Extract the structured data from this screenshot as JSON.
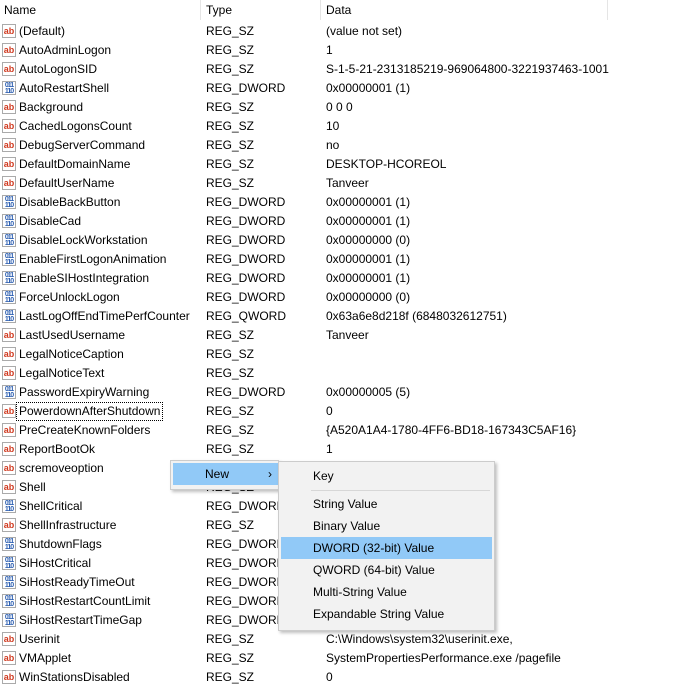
{
  "header": {
    "name": "Name",
    "type": "Type",
    "data": "Data"
  },
  "rows": [
    {
      "name": "(Default)",
      "type": "REG_SZ",
      "data": "(value not set)",
      "icon": "string"
    },
    {
      "name": "AutoAdminLogon",
      "type": "REG_SZ",
      "data": "1",
      "icon": "string"
    },
    {
      "name": "AutoLogonSID",
      "type": "REG_SZ",
      "data": "S-1-5-21-2313185219-969064800-3221937463-1001",
      "icon": "string"
    },
    {
      "name": "AutoRestartShell",
      "type": "REG_DWORD",
      "data": "0x00000001 (1)",
      "icon": "binary"
    },
    {
      "name": "Background",
      "type": "REG_SZ",
      "data": "0 0 0",
      "icon": "string"
    },
    {
      "name": "CachedLogonsCount",
      "type": "REG_SZ",
      "data": "10",
      "icon": "string"
    },
    {
      "name": "DebugServerCommand",
      "type": "REG_SZ",
      "data": "no",
      "icon": "string"
    },
    {
      "name": "DefaultDomainName",
      "type": "REG_SZ",
      "data": "DESKTOP-HCOREOL",
      "icon": "string"
    },
    {
      "name": "DefaultUserName",
      "type": "REG_SZ",
      "data": "Tanveer",
      "icon": "string"
    },
    {
      "name": "DisableBackButton",
      "type": "REG_DWORD",
      "data": "0x00000001 (1)",
      "icon": "binary"
    },
    {
      "name": "DisableCad",
      "type": "REG_DWORD",
      "data": "0x00000001 (1)",
      "icon": "binary"
    },
    {
      "name": "DisableLockWorkstation",
      "type": "REG_DWORD",
      "data": "0x00000000 (0)",
      "icon": "binary"
    },
    {
      "name": "EnableFirstLogonAnimation",
      "type": "REG_DWORD",
      "data": "0x00000001 (1)",
      "icon": "binary"
    },
    {
      "name": "EnableSIHostIntegration",
      "type": "REG_DWORD",
      "data": "0x00000001 (1)",
      "icon": "binary"
    },
    {
      "name": "ForceUnlockLogon",
      "type": "REG_DWORD",
      "data": "0x00000000 (0)",
      "icon": "binary"
    },
    {
      "name": "LastLogOffEndTimePerfCounter",
      "type": "REG_QWORD",
      "data": "0x63a6e8d218f (6848032612751)",
      "icon": "binary"
    },
    {
      "name": "LastUsedUsername",
      "type": "REG_SZ",
      "data": "Tanveer",
      "icon": "string"
    },
    {
      "name": "LegalNoticeCaption",
      "type": "REG_SZ",
      "data": "",
      "icon": "string"
    },
    {
      "name": "LegalNoticeText",
      "type": "REG_SZ",
      "data": "",
      "icon": "string"
    },
    {
      "name": "PasswordExpiryWarning",
      "type": "REG_DWORD",
      "data": "0x00000005 (5)",
      "icon": "binary"
    },
    {
      "name": "PowerdownAfterShutdown",
      "type": "REG_SZ",
      "data": "0",
      "icon": "string",
      "focused": true
    },
    {
      "name": "PreCreateKnownFolders",
      "type": "REG_SZ",
      "data": "{A520A1A4-1780-4FF6-BD18-167343C5AF16}",
      "icon": "string"
    },
    {
      "name": "ReportBootOk",
      "type": "REG_SZ",
      "data": "1",
      "icon": "string"
    },
    {
      "name": "scremoveoption",
      "type": "",
      "data": "",
      "icon": "string"
    },
    {
      "name": "Shell",
      "type": "REG_SZ",
      "data": "",
      "icon": "string"
    },
    {
      "name": "ShellCritical",
      "type": "REG_DWORD",
      "data": "",
      "icon": "binary"
    },
    {
      "name": "ShellInfrastructure",
      "type": "REG_SZ",
      "data": "",
      "icon": "string"
    },
    {
      "name": "ShutdownFlags",
      "type": "REG_DWORD",
      "data": "",
      "icon": "binary"
    },
    {
      "name": "SiHostCritical",
      "type": "REG_DWORD",
      "data": "",
      "icon": "binary"
    },
    {
      "name": "SiHostReadyTimeOut",
      "type": "REG_DWORD",
      "data": "",
      "icon": "binary"
    },
    {
      "name": "SiHostRestartCountLimit",
      "type": "REG_DWORD",
      "data": "",
      "icon": "binary"
    },
    {
      "name": "SiHostRestartTimeGap",
      "type": "REG_DWORD",
      "data": "",
      "icon": "binary"
    },
    {
      "name": "Userinit",
      "type": "REG_SZ",
      "data": "C:\\Windows\\system32\\userinit.exe,",
      "icon": "string"
    },
    {
      "name": "VMApplet",
      "type": "REG_SZ",
      "data": "SystemPropertiesPerformance.exe /pagefile",
      "icon": "string"
    },
    {
      "name": "WinStationsDisabled",
      "type": "REG_SZ",
      "data": "0",
      "icon": "string"
    }
  ],
  "context_menu": {
    "new_label": "New",
    "arrow": "›"
  },
  "submenu": {
    "items": [
      "Key",
      "String Value",
      "Binary Value",
      "DWORD (32-bit) Value",
      "QWORD (64-bit) Value",
      "Multi-String Value",
      "Expandable String Value"
    ],
    "highlighted": "DWORD (32-bit) Value"
  },
  "colors": {
    "highlight": "#91c9f7",
    "string_icon": "#d03a20",
    "binary_icon": "#2a5db0"
  }
}
